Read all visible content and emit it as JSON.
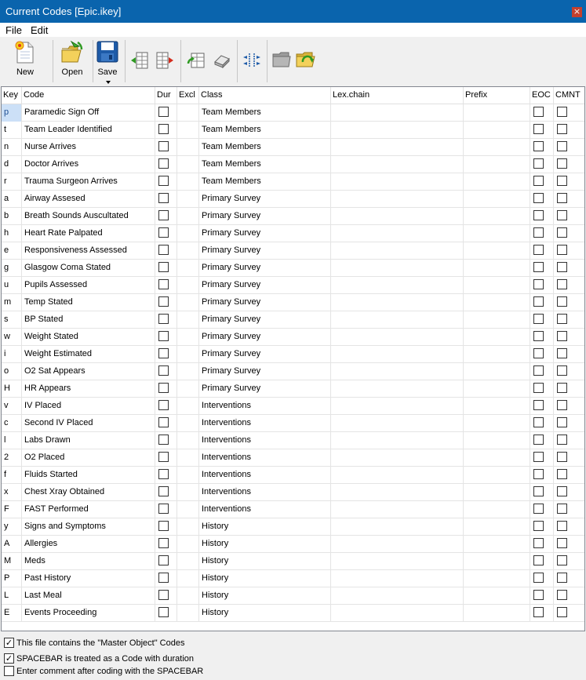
{
  "window": {
    "title": "Current Codes [Epic.ikey]",
    "close_glyph": "×"
  },
  "menu": {
    "items": [
      "File",
      "Edit"
    ]
  },
  "toolbar": {
    "new_label": "New",
    "open_label": "Open",
    "save_label": "Save"
  },
  "grid": {
    "columns": [
      "Key",
      "Code",
      "Dur",
      "Excl",
      "Class",
      "Lex.chain",
      "Prefix",
      "EOC",
      "CMNT"
    ],
    "rows": [
      {
        "key": "p",
        "code": "Paramedic Sign Off",
        "class": "Team Members"
      },
      {
        "key": "t",
        "code": "Team Leader Identified",
        "class": "Team Members"
      },
      {
        "key": "n",
        "code": "Nurse Arrives",
        "class": "Team Members"
      },
      {
        "key": "d",
        "code": "Doctor Arrives",
        "class": "Team Members"
      },
      {
        "key": "r",
        "code": "Trauma Surgeon Arrives",
        "class": "Team Members"
      },
      {
        "key": "a",
        "code": "Airway Assesed",
        "class": "Primary Survey"
      },
      {
        "key": "b",
        "code": "Breath Sounds Auscultated",
        "class": "Primary Survey"
      },
      {
        "key": "h",
        "code": "Heart Rate Palpated",
        "class": "Primary Survey"
      },
      {
        "key": "e",
        "code": "Responsiveness Assessed",
        "class": "Primary Survey"
      },
      {
        "key": "g",
        "code": "Glasgow Coma Stated",
        "class": "Primary Survey"
      },
      {
        "key": "u",
        "code": "Pupils Assessed",
        "class": "Primary Survey"
      },
      {
        "key": "m",
        "code": "Temp Stated",
        "class": "Primary Survey"
      },
      {
        "key": "s",
        "code": "BP Stated",
        "class": "Primary Survey"
      },
      {
        "key": "w",
        "code": "Weight Stated",
        "class": "Primary Survey"
      },
      {
        "key": "i",
        "code": "Weight Estimated",
        "class": "Primary Survey"
      },
      {
        "key": "o",
        "code": "O2 Sat Appears",
        "class": "Primary Survey"
      },
      {
        "key": "H",
        "code": "HR Appears",
        "class": "Primary Survey"
      },
      {
        "key": "v",
        "code": "IV Placed",
        "class": "Interventions"
      },
      {
        "key": "c",
        "code": "Second IV Placed",
        "class": "Interventions"
      },
      {
        "key": "l",
        "code": "Labs Drawn",
        "class": "Interventions"
      },
      {
        "key": "2",
        "code": "O2 Placed",
        "class": "Interventions"
      },
      {
        "key": "f",
        "code": "Fluids Started",
        "class": "Interventions"
      },
      {
        "key": "x",
        "code": "Chest Xray Obtained",
        "class": "Interventions"
      },
      {
        "key": "F",
        "code": "FAST Performed",
        "class": "Interventions"
      },
      {
        "key": "y",
        "code": "Signs and Symptoms",
        "class": "History"
      },
      {
        "key": "A",
        "code": "Allergies",
        "class": "History"
      },
      {
        "key": "M",
        "code": "Meds",
        "class": "History"
      },
      {
        "key": "P",
        "code": "Past History",
        "class": "History"
      },
      {
        "key": "L",
        "code": "Last Meal",
        "class": "History"
      },
      {
        "key": "E",
        "code": "Events Proceeding",
        "class": "History"
      }
    ]
  },
  "options": [
    {
      "label": "This file contains the \"Master Object\" Codes",
      "checked": true
    },
    {
      "label": "SPACEBAR is treated as a Code with duration",
      "checked": true
    },
    {
      "label": "Enter comment after coding with the SPACEBAR",
      "checked": false
    }
  ],
  "colors": {
    "titlebar": "#0a64ad",
    "close": "#c4402e",
    "selection": "#cce0f7"
  }
}
